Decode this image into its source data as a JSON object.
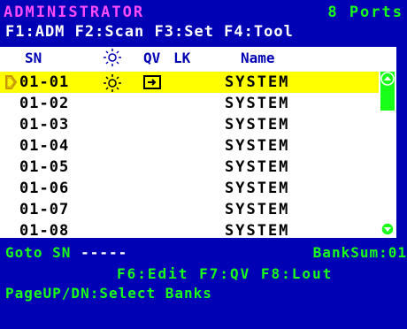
{
  "header": {
    "user": "ADMINISTRATOR",
    "ports": "8 Ports",
    "function_keys": "F1:ADM F2:Scan F3:Set F4:Tool"
  },
  "columns": {
    "sn": "SN",
    "qv": "QV",
    "lk": "LK",
    "name": "Name"
  },
  "rows": [
    {
      "sn": "01-01",
      "name": "SYSTEM",
      "selected": true
    },
    {
      "sn": "01-02",
      "name": "SYSTEM"
    },
    {
      "sn": "01-03",
      "name": "SYSTEM"
    },
    {
      "sn": "01-04",
      "name": "SYSTEM"
    },
    {
      "sn": "01-05",
      "name": "SYSTEM"
    },
    {
      "sn": "01-06",
      "name": "SYSTEM"
    },
    {
      "sn": "01-07",
      "name": "SYSTEM"
    },
    {
      "sn": "01-08",
      "name": "SYSTEM"
    }
  ],
  "footer": {
    "goto_label": "Goto SN",
    "goto_value": "-----",
    "banksum": "BankSum:01",
    "function_keys": "F6:Edit F7:QV F8:Lout",
    "page_hint": "PageUP/DN:Select Banks"
  },
  "colors": {
    "background": "#0000b4",
    "accent": "#18ff18",
    "title": "#ff4cff",
    "selection": "#ffff00"
  },
  "icons": {
    "power": "sun-icon",
    "quickview": "quickview-icon",
    "selected": "selector-arrow-icon"
  }
}
